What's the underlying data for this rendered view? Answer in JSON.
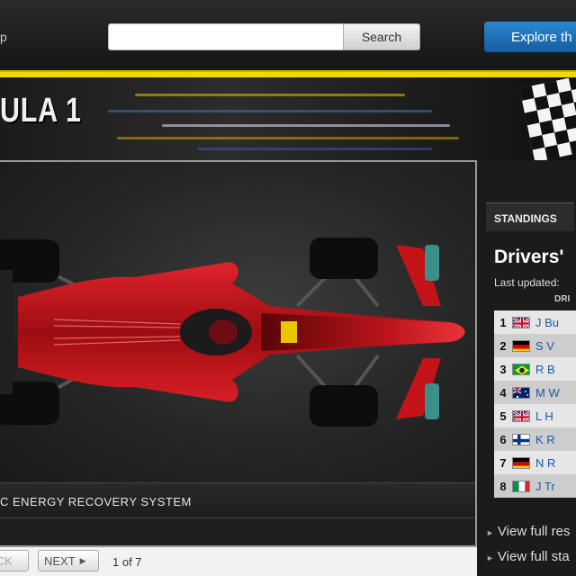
{
  "header": {
    "left_text": "p",
    "search_placeholder": "",
    "search_button": "Search",
    "explore_button": "Explore th"
  },
  "banner": {
    "title": "ULA 1"
  },
  "viewer": {
    "caption": "C ENERGY RECOVERY SYSTEM",
    "back_label": "ACK",
    "next_label": "NEXT",
    "page_count": "1 of 7"
  },
  "sidebar": {
    "tab": "STANDINGS",
    "title": "Drivers'",
    "last_updated": "Last updated:",
    "column_header": "DRI",
    "drivers": [
      {
        "pos": "1",
        "flag": "uk",
        "name": "J Bu"
      },
      {
        "pos": "2",
        "flag": "germany",
        "name": "S V"
      },
      {
        "pos": "3",
        "flag": "brazil",
        "name": "R B"
      },
      {
        "pos": "4",
        "flag": "australia",
        "name": "M W"
      },
      {
        "pos": "5",
        "flag": "uk",
        "name": "L H"
      },
      {
        "pos": "6",
        "flag": "finland",
        "name": "K R"
      },
      {
        "pos": "7",
        "flag": "germany",
        "name": "N R"
      },
      {
        "pos": "8",
        "flag": "italy",
        "name": "J Tr"
      }
    ],
    "links": [
      "View full res",
      "View full sta"
    ]
  },
  "colors": {
    "accent_yellow": "#f2d800",
    "explore_blue": "#1f77bf",
    "car_red": "#c4141a"
  }
}
